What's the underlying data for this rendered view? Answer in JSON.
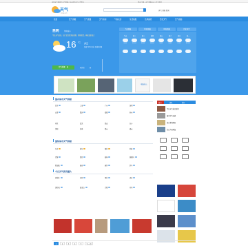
{
  "topbar": {
    "left": "中国天气网旗下天气预报 | 每天有约2亿人次到访",
    "right": "登录 注册 | 天气预报15天 | 设为首页"
  },
  "header": {
    "logo": "天气",
    "logo_sub": "tianqi.com",
    "links": "天气 预报 新闻"
  },
  "nav": {
    "items": [
      "首页",
      "天气预报",
      "空气质量",
      "天气新闻",
      "气象灾害",
      "生活指数",
      "台风路径",
      "历史天气",
      "天气视频",
      "降雨量"
    ]
  },
  "current": {
    "city": "昆明",
    "sub": "切换城市",
    "alert": "今日天气较凉，出门请注意添加衣物，预防感冒，昼夜温差较大",
    "temp": "16",
    "deg": "°C",
    "cond": "多云",
    "detail": "湿度 60%  风向 西南风2级",
    "aqi": "空气质量：良",
    "stat1": "紫外线",
    "stat2": "弱"
  },
  "forecast": {
    "tabs": [
      "7天预报",
      "15天预报",
      "40天预报",
      "历史天气"
    ],
    "days": [
      {
        "d": "今天",
        "t": "20/9°"
      },
      {
        "d": "周二",
        "t": "21/10°"
      },
      {
        "d": "周三",
        "t": "22/11°"
      },
      {
        "d": "周四",
        "t": "19/10°"
      },
      {
        "d": "周五",
        "t": "18/9°"
      },
      {
        "d": "周六",
        "t": "20/8°"
      },
      {
        "d": "周日",
        "t": "21/9°"
      },
      {
        "d": "周一",
        "t": "22/10°"
      }
    ]
  },
  "ad": {
    "label": "电脑办公",
    "sub": "品质生活"
  },
  "sections": [
    {
      "title": "国内城市天气预报"
    },
    {
      "title": "国际城市天气预报"
    },
    {
      "title": "今日天气资讯图片"
    }
  ],
  "cities": [
    [
      "北京",
      "上海",
      "广州",
      "深圳"
    ],
    [
      "天津",
      "重庆",
      "成都",
      "杭州"
    ],
    [
      "南京",
      "武汉",
      "西安",
      "长沙"
    ],
    [
      "沈阳",
      "济南",
      "郑州",
      "福州"
    ]
  ],
  "cities2": [
    [
      "东京",
      "首尔",
      "纽约",
      "伦敦"
    ],
    [
      "巴黎",
      "悉尼",
      "柏林",
      "莫斯科"
    ],
    [
      "新加坡",
      "曼谷",
      "迪拜",
      "罗马"
    ],
    [
      "多伦多",
      "开罗",
      "里约",
      "孟买"
    ],
    [
      "洛杉矶",
      "旧金山",
      "大阪",
      "河内"
    ]
  ],
  "right": {
    "tabs": [
      "热门",
      "资讯",
      "排行"
    ],
    "items": [
      "今日天气热点新闻",
      "强冷空气来袭",
      "南方多地降雨",
      "北方大风降温",
      "台风最新消息",
      "气象科普知识"
    ]
  },
  "pager": {
    "items": [
      "1",
      "2",
      "3",
      "4",
      "5",
      "下一页"
    ]
  },
  "colors": {
    "brand": "#2b8ce0",
    "banner": "#3b98e9",
    "aqi": "#4eb849"
  }
}
